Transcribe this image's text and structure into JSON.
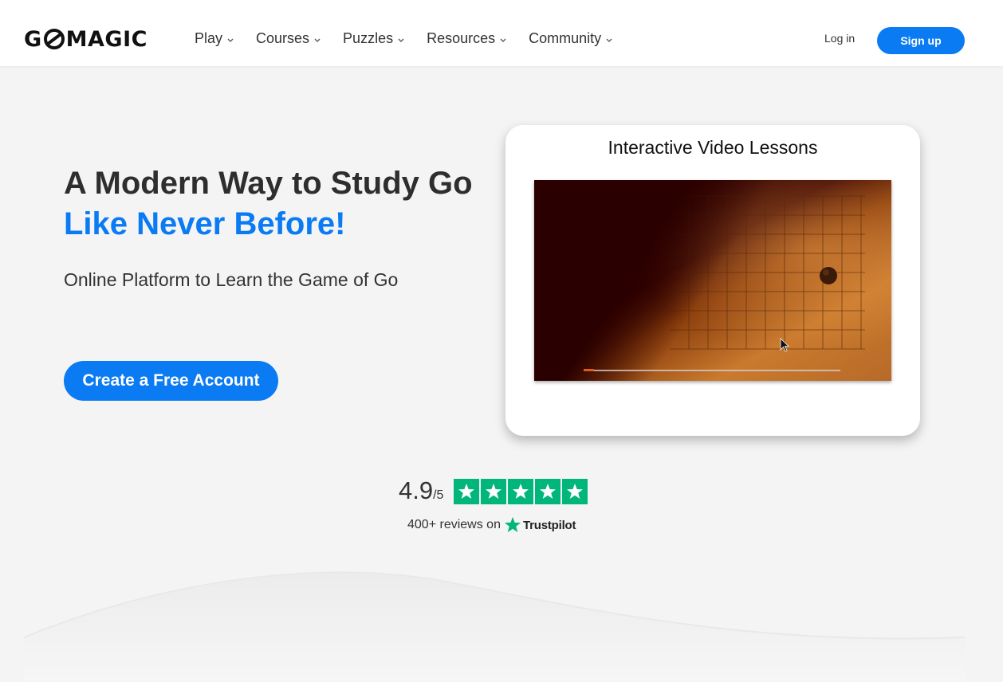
{
  "header": {
    "logo_text_left": "G",
    "logo_text_right": "MAGIC",
    "nav": [
      {
        "label": "Play"
      },
      {
        "label": "Courses"
      },
      {
        "label": "Puzzles"
      },
      {
        "label": "Resources"
      },
      {
        "label": "Community"
      }
    ],
    "login_label": "Log in",
    "signup_label": "Sign up"
  },
  "hero": {
    "title_line1": "A Modern Way to Study Go",
    "title_line2": "Like Never Before!",
    "subtitle": "Online Platform to Learn the Game of Go",
    "cta_label": "Create a Free Account"
  },
  "video_card": {
    "title": "Interactive Video Lessons",
    "progress_fraction": 0.04
  },
  "rating": {
    "score": "4.9",
    "denominator": "/5",
    "stars": 5,
    "reviews_text": "400+ reviews on",
    "provider": "Trustpilot"
  },
  "colors": {
    "accent": "#0a7bf3",
    "trustpilot_green": "#00b67a",
    "background": "#f4f4f4"
  },
  "icons": [
    "chevron-down-icon",
    "star-icon",
    "trustpilot-star-icon",
    "cursor-icon"
  ]
}
